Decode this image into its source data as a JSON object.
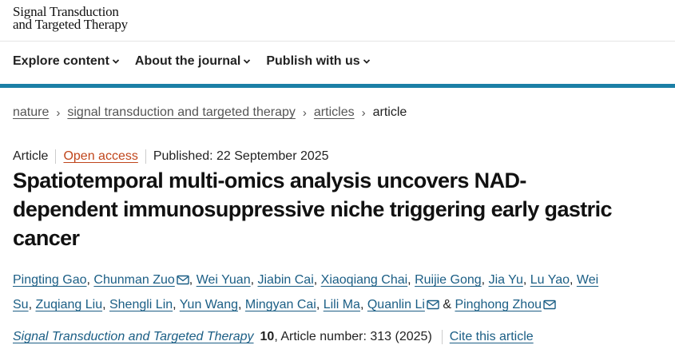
{
  "site": {
    "logo_line1": "Signal Transduction",
    "logo_line2": "and Targeted Therapy"
  },
  "nav": [
    {
      "label": "Explore content"
    },
    {
      "label": "About the journal"
    },
    {
      "label": "Publish with us"
    }
  ],
  "breadcrumb": [
    {
      "label": "nature"
    },
    {
      "label": "signal transduction and targeted therapy"
    },
    {
      "label": "articles"
    },
    {
      "label": "article"
    }
  ],
  "article": {
    "type": "Article",
    "access": "Open access",
    "published": "Published: 22 September 2025",
    "title": "Spatiotemporal multi-omics analysis uncovers NAD-dependent immunosuppressive niche triggering early gastric cancer",
    "authors": [
      {
        "name": "Pingting Gao"
      },
      {
        "name": "Chunman Zuo",
        "mail": true
      },
      {
        "name": "Wei Yuan"
      },
      {
        "name": "Jiabin Cai"
      },
      {
        "name": "Xiaoqiang Chai"
      },
      {
        "name": "Ruijie Gong"
      },
      {
        "name": "Jia Yu"
      },
      {
        "name": "Lu Yao"
      },
      {
        "name": "Wei Su"
      },
      {
        "name": "Zuqiang Liu"
      },
      {
        "name": "Shengli Lin"
      },
      {
        "name": "Yun Wang"
      },
      {
        "name": "Mingyan Cai"
      },
      {
        "name": "Lili Ma"
      },
      {
        "name": "Quanlin Li",
        "mail": true
      },
      {
        "name": "Pinghong Zhou",
        "mail": true
      }
    ],
    "journal": "Signal Transduction and Targeted Therapy",
    "volume": "10",
    "article_number": ", Article number: 313 (2025)",
    "cite_label": "Cite this article"
  },
  "colors": {
    "accent_bar": "#1b7fa6",
    "link": "#1b5e85",
    "open_access": "#c0461c"
  },
  "icons": [
    "chevron-down-icon",
    "mail-icon"
  ]
}
